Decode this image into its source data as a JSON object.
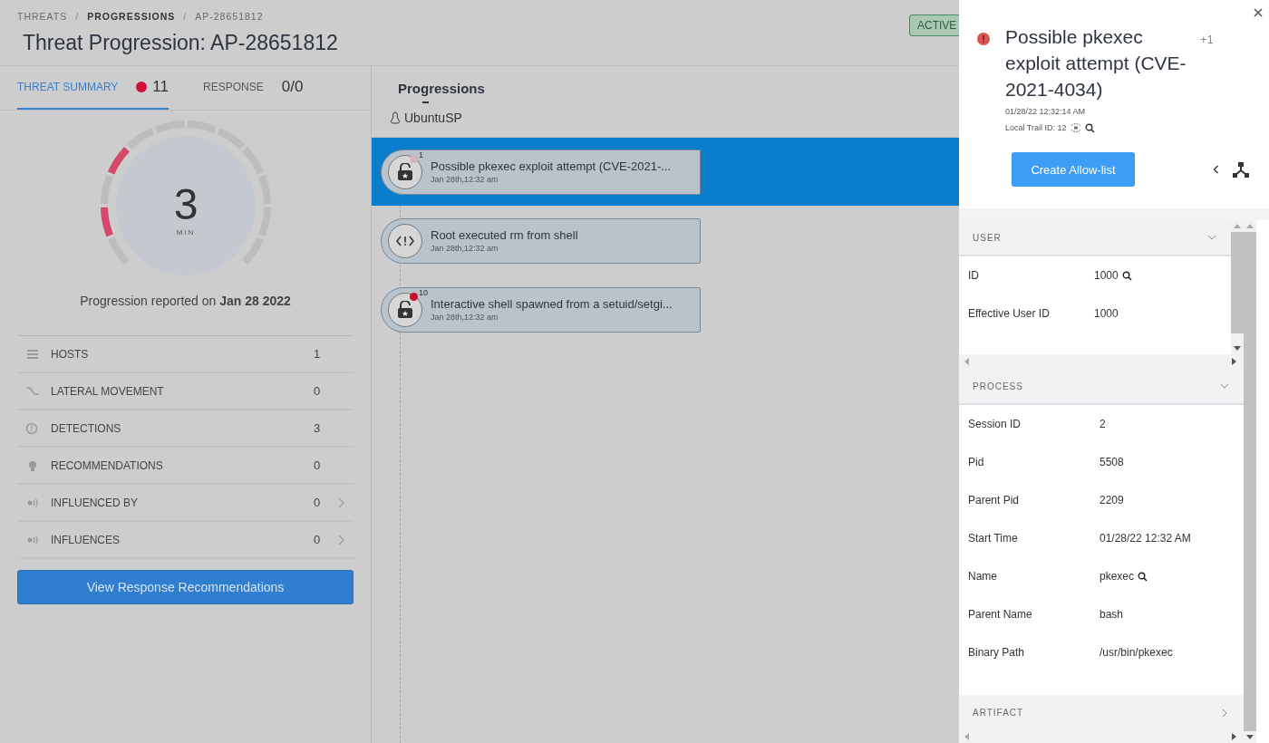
{
  "breadcrumb": [
    {
      "label": "THREATS",
      "active": false
    },
    {
      "label": "PROGRESSIONS",
      "active": true
    },
    {
      "label": "AP-28651812",
      "active": false
    }
  ],
  "breadcrumb_separator": "/",
  "title": "Threat Progression: AP-28651812",
  "status_badge": "ACTIVE",
  "tabs": [
    {
      "label": "THREAT SUMMARY",
      "count": "11",
      "dot": true,
      "selected": true
    },
    {
      "label": "RESPONSE",
      "count": "0/0",
      "dot": false,
      "selected": false
    }
  ],
  "gauge": {
    "value": "3",
    "unit": "MIN",
    "segments": [
      {
        "on": false
      },
      {
        "on": true
      },
      {
        "on": false
      },
      {
        "on": true
      },
      {
        "on": false
      },
      {
        "on": false
      },
      {
        "on": false
      },
      {
        "on": false
      },
      {
        "on": false
      },
      {
        "on": false
      },
      {
        "on": false
      },
      {
        "on": false
      }
    ]
  },
  "reported": "Progression reported on **Jan 28 2022**",
  "stats": [
    {
      "kind": "hosts",
      "label": "HOSTS",
      "value": "1",
      "expandable": false
    },
    {
      "kind": "lateral",
      "label": "LATERAL MOVEMENT",
      "value": "0",
      "expandable": false
    },
    {
      "kind": "detections",
      "label": "DETECTIONS",
      "value": "3",
      "expandable": false
    },
    {
      "kind": "bulb",
      "label": "RECOMMENDATIONS",
      "value": "0",
      "expandable": false
    },
    {
      "kind": "signal",
      "label": "INFLUENCED BY",
      "value": "0",
      "expandable": true
    },
    {
      "kind": "signal",
      "label": "INFLUENCES",
      "value": "0",
      "expandable": true
    }
  ],
  "response_button": "View Response Recommendations",
  "progressions": {
    "title": "Progressions",
    "host": "UbuntuSP",
    "items": [
      {
        "kind": "lock",
        "badge": "1",
        "color": "#d8b4bb",
        "title": "Possible pkexec exploit attempt (CVE-2021-...",
        "time": "Jan 28th,12:32 am",
        "selected": true
      },
      {
        "kind": "code",
        "title": "Root executed rm from shell",
        "time": "Jan 28th,12:32 am",
        "selected": false
      },
      {
        "kind": "lock",
        "badge": "10",
        "color": "#c8102e",
        "title": "Interactive shell spawned from a setuid/setgi...",
        "time": "Jan 28th,12:32 am",
        "selected": false
      }
    ]
  },
  "drawer": {
    "title": "Possible pkexec exploit attempt (CVE-2021-4034)",
    "extra": "+1",
    "timestamp": "01/28/22 12:32:14 AM",
    "trail_id": "Local Trail ID: 12",
    "button": "Create Allow-list",
    "sections": [
      {
        "title": "USER",
        "expanded": true,
        "rows": [
          {
            "label": "ID",
            "value": "1000",
            "search": true
          },
          {
            "label": "Effective User ID",
            "value": "1000",
            "search": false
          }
        ]
      },
      {
        "title": "PROCESS",
        "expanded": true,
        "rows": [
          {
            "label": "Session ID",
            "value": "2",
            "search": false
          },
          {
            "label": "Pid",
            "value": "5508",
            "search": false
          },
          {
            "label": "Parent Pid",
            "value": "2209",
            "search": false
          },
          {
            "label": "Start Time",
            "value": "01/28/22 12:32 AM",
            "search": false
          },
          {
            "label": "Name",
            "value": "pkexec",
            "search": true
          },
          {
            "label": "Parent Name",
            "value": "bash",
            "search": false
          },
          {
            "label": "Binary Path",
            "value": "/usr/bin/pkexec",
            "search": false
          }
        ]
      },
      {
        "title": "ARTIFACT",
        "expanded": false
      }
    ]
  }
}
